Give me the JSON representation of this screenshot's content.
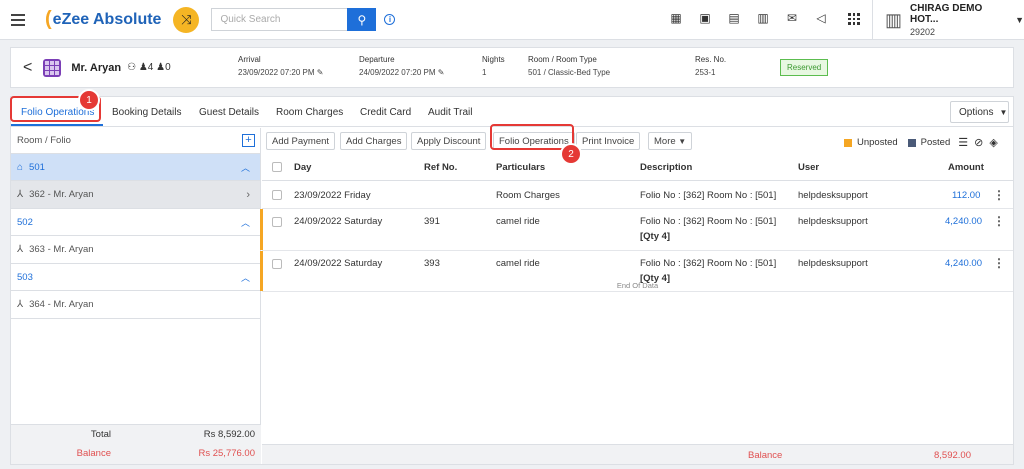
{
  "app": {
    "name": "eZee Absolute",
    "search_placeholder": "Quick Search",
    "property_name": "CHIRAG DEMO HOT...",
    "property_code": "29202"
  },
  "reservation": {
    "guest": "Mr. Aryan",
    "adults": "4",
    "children": "0",
    "arrival_label": "Arrival",
    "arrival": "23/09/2022 07:20 PM",
    "departure_label": "Departure",
    "departure": "24/09/2022 07:20 PM",
    "nights_label": "Nights",
    "nights": "1",
    "room_label": "Room / Room Type",
    "room": "501 / Classic-Bed Type",
    "resno_label": "Res. No.",
    "resno": "253-1",
    "status": "Reserved"
  },
  "tabs": [
    "Folio Operations",
    "Booking Details",
    "Guest Details",
    "Room Charges",
    "Credit Card",
    "Audit Trail"
  ],
  "options_label": "Options",
  "left": {
    "header": "Room / Folio",
    "rooms": [
      {
        "room": "501",
        "folio": "362 - Mr. Aryan"
      },
      {
        "room": "502",
        "folio": "363 - Mr. Aryan"
      },
      {
        "room": "503",
        "folio": "364 - Mr. Aryan"
      }
    ],
    "total_label": "Total",
    "total": "Rs 8,592.00",
    "balance_label": "Balance",
    "balance": "Rs 25,776.00"
  },
  "toolbar": {
    "add_payment": "Add Payment",
    "add_charges": "Add Charges",
    "apply_discount": "Apply Discount",
    "folio_operations": "Folio Operations",
    "print_invoice": "Print Invoice",
    "more": "More",
    "unposted": "Unposted",
    "posted": "Posted"
  },
  "columns": {
    "day": "Day",
    "ref": "Ref No.",
    "particulars": "Particulars",
    "description": "Description",
    "user": "User",
    "amount": "Amount"
  },
  "rows": [
    {
      "day": "23/09/2022 Friday",
      "ref": "",
      "particulars": "Room Charges",
      "description": "Folio No : [362] Room No : [501]",
      "qty": "",
      "user": "helpdesksupport",
      "amount": "112.00"
    },
    {
      "day": "24/09/2022 Saturday",
      "ref": "391",
      "particulars": "camel ride",
      "description": "Folio No : [362] Room No : [501]",
      "qty": "[Qty 4]",
      "user": "helpdesksupport",
      "amount": "4,240.00"
    },
    {
      "day": "24/09/2022 Saturday",
      "ref": "393",
      "particulars": "camel ride",
      "description": "Folio No : [362] Room No : [501]",
      "qty": "[Qty 4]",
      "user": "helpdesksupport",
      "amount": "4,240.00"
    }
  ],
  "end_of_data": "End Of Data",
  "footer": {
    "balance_label": "Balance",
    "balance": "8,592.00"
  },
  "annotations": {
    "one": "1",
    "two": "2"
  },
  "colors": {
    "accent": "#1e6fd9",
    "unposted": "#f5a623",
    "posted": "#4a5a78",
    "highlight": "#e53935"
  }
}
